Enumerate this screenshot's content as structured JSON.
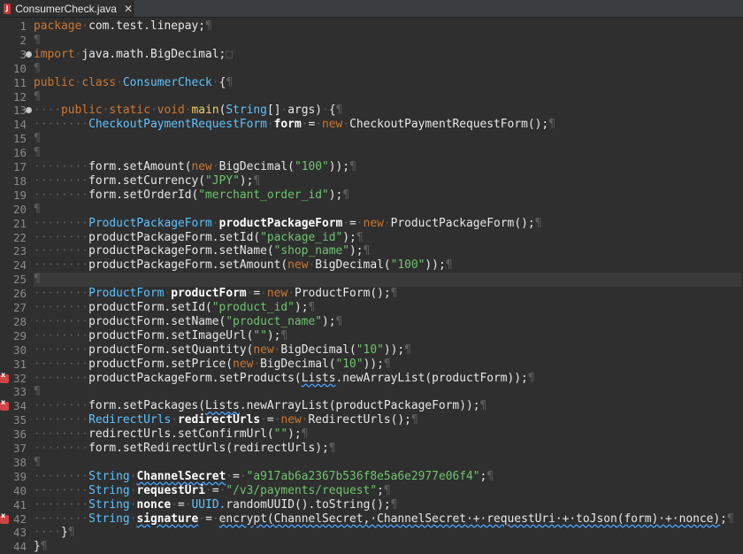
{
  "tab": {
    "title": "ConsumerCheck.java",
    "icon": "java-file-icon",
    "close_icon": "close-icon"
  },
  "gutter": {
    "line_numbers": [
      "1",
      "2",
      "3",
      "10",
      "11",
      "12",
      "13",
      "14",
      "15",
      "16",
      "17",
      "18",
      "19",
      "20",
      "21",
      "22",
      "23",
      "24",
      "25",
      "26",
      "27",
      "28",
      "29",
      "30",
      "31",
      "32",
      "33",
      "34",
      "35",
      "36",
      "37",
      "38",
      "39",
      "40",
      "41",
      "42",
      "43",
      "44"
    ],
    "fold_markers_lines": [
      "3",
      "13"
    ],
    "error_markers_lines": [
      "32",
      "34",
      "42"
    ]
  },
  "code": [
    {
      "tokens": [
        [
          "kw",
          "package"
        ],
        [
          "ws",
          "·"
        ],
        [
          "txt",
          "com.test.linepay;"
        ],
        [
          "ws",
          "¶"
        ]
      ]
    },
    {
      "tokens": [
        [
          "ws",
          "¶"
        ]
      ]
    },
    {
      "tokens": [
        [
          "kw",
          "import"
        ],
        [
          "ws",
          "·"
        ],
        [
          "txt",
          "java.math.BigDecimal;"
        ],
        [
          "ws",
          "□"
        ]
      ]
    },
    {
      "tokens": [
        [
          "ws",
          "¶"
        ]
      ]
    },
    {
      "tokens": [
        [
          "kw",
          "public"
        ],
        [
          "ws",
          "·"
        ],
        [
          "kw",
          "class"
        ],
        [
          "ws",
          "·"
        ],
        [
          "ty",
          "ConsumerCheck"
        ],
        [
          "ws",
          "·"
        ],
        [
          "txt",
          "{"
        ],
        [
          "ws",
          "¶"
        ]
      ]
    },
    {
      "tokens": [
        [
          "ws",
          "¶"
        ]
      ]
    },
    {
      "tokens": [
        [
          "ws",
          "····"
        ],
        [
          "kw",
          "public"
        ],
        [
          "ws",
          "·"
        ],
        [
          "kw",
          "static"
        ],
        [
          "ws",
          "·"
        ],
        [
          "kw",
          "void"
        ],
        [
          "ws",
          "·"
        ],
        [
          "method",
          "main"
        ],
        [
          "txt",
          "("
        ],
        [
          "ty",
          "String"
        ],
        [
          "txt",
          "[]"
        ],
        [
          "ws",
          "·"
        ],
        [
          "txt",
          "args)"
        ],
        [
          "ws",
          "·"
        ],
        [
          "txt",
          "{"
        ],
        [
          "ws",
          "¶"
        ]
      ]
    },
    {
      "tokens": [
        [
          "ws",
          "········"
        ],
        [
          "ty",
          "CheckoutPaymentRequestForm"
        ],
        [
          "ws",
          "·"
        ],
        [
          "fld",
          "form"
        ],
        [
          "ws",
          "·"
        ],
        [
          "txt",
          "="
        ],
        [
          "ws",
          "·"
        ],
        [
          "kw",
          "new"
        ],
        [
          "ws",
          "·"
        ],
        [
          "txt",
          "CheckoutPaymentRequestForm();"
        ],
        [
          "ws",
          "¶"
        ]
      ]
    },
    {
      "tokens": [
        [
          "ws",
          "¶"
        ]
      ]
    },
    {
      "tokens": [
        [
          "ws",
          "¶"
        ]
      ]
    },
    {
      "tokens": [
        [
          "ws",
          "········"
        ],
        [
          "txt",
          "form.setAmount("
        ],
        [
          "kw",
          "new"
        ],
        [
          "ws",
          "·"
        ],
        [
          "txt",
          "BigDecimal("
        ],
        [
          "str",
          "\"100\""
        ],
        [
          "txt",
          "));"
        ],
        [
          "ws",
          "¶"
        ]
      ]
    },
    {
      "tokens": [
        [
          "ws",
          "········"
        ],
        [
          "txt",
          "form.setCurrency("
        ],
        [
          "str",
          "\"JPY\""
        ],
        [
          "txt",
          ");"
        ],
        [
          "ws",
          "¶"
        ]
      ]
    },
    {
      "tokens": [
        [
          "ws",
          "········"
        ],
        [
          "txt",
          "form.setOrderId("
        ],
        [
          "str",
          "\"merchant_order_id\""
        ],
        [
          "txt",
          ");"
        ],
        [
          "ws",
          "¶"
        ]
      ]
    },
    {
      "tokens": [
        [
          "ws",
          "¶"
        ]
      ]
    },
    {
      "tokens": [
        [
          "ws",
          "········"
        ],
        [
          "ty",
          "ProductPackageForm"
        ],
        [
          "ws",
          "·"
        ],
        [
          "fld",
          "productPackageForm"
        ],
        [
          "ws",
          "·"
        ],
        [
          "txt",
          "="
        ],
        [
          "ws",
          "·"
        ],
        [
          "kw",
          "new"
        ],
        [
          "ws",
          "·"
        ],
        [
          "txt",
          "ProductPackageForm();"
        ],
        [
          "ws",
          "¶"
        ]
      ]
    },
    {
      "tokens": [
        [
          "ws",
          "········"
        ],
        [
          "txt",
          "productPackageForm.setId("
        ],
        [
          "str",
          "\"package_id\""
        ],
        [
          "txt",
          ");"
        ],
        [
          "ws",
          "¶"
        ]
      ]
    },
    {
      "tokens": [
        [
          "ws",
          "········"
        ],
        [
          "txt",
          "productPackageForm.setName("
        ],
        [
          "str",
          "\"shop_name\""
        ],
        [
          "txt",
          ");"
        ],
        [
          "ws",
          "¶"
        ]
      ]
    },
    {
      "tokens": [
        [
          "ws",
          "········"
        ],
        [
          "txt",
          "productPackageForm.setAmount("
        ],
        [
          "kw",
          "new"
        ],
        [
          "ws",
          "·"
        ],
        [
          "txt",
          "BigDecimal("
        ],
        [
          "str",
          "\"100\""
        ],
        [
          "txt",
          "));"
        ],
        [
          "ws",
          "¶"
        ]
      ]
    },
    {
      "tokens": [
        [
          "ws",
          "¶"
        ]
      ],
      "current": true
    },
    {
      "tokens": [
        [
          "ws",
          "········"
        ],
        [
          "ty",
          "ProductForm"
        ],
        [
          "ws",
          "·"
        ],
        [
          "fld",
          "productForm"
        ],
        [
          "ws",
          "·"
        ],
        [
          "txt",
          "="
        ],
        [
          "ws",
          "·"
        ],
        [
          "kw",
          "new"
        ],
        [
          "ws",
          "·"
        ],
        [
          "txt",
          "ProductForm();"
        ],
        [
          "ws",
          "¶"
        ]
      ]
    },
    {
      "tokens": [
        [
          "ws",
          "········"
        ],
        [
          "txt",
          "productForm.setId("
        ],
        [
          "str",
          "\"product_id\""
        ],
        [
          "txt",
          ");"
        ],
        [
          "ws",
          "¶"
        ]
      ]
    },
    {
      "tokens": [
        [
          "ws",
          "········"
        ],
        [
          "txt",
          "productForm.setName("
        ],
        [
          "str",
          "\"product_name\""
        ],
        [
          "txt",
          ");"
        ],
        [
          "ws",
          "¶"
        ]
      ]
    },
    {
      "tokens": [
        [
          "ws",
          "········"
        ],
        [
          "txt",
          "productForm.setImageUrl("
        ],
        [
          "str",
          "\"\""
        ],
        [
          "txt",
          ");"
        ],
        [
          "ws",
          "¶"
        ]
      ]
    },
    {
      "tokens": [
        [
          "ws",
          "········"
        ],
        [
          "txt",
          "productForm.setQuantity("
        ],
        [
          "kw",
          "new"
        ],
        [
          "ws",
          "·"
        ],
        [
          "txt",
          "BigDecimal("
        ],
        [
          "str",
          "\"10\""
        ],
        [
          "txt",
          "));"
        ],
        [
          "ws",
          "¶"
        ]
      ]
    },
    {
      "tokens": [
        [
          "ws",
          "········"
        ],
        [
          "txt",
          "productForm.setPrice("
        ],
        [
          "kw",
          "new"
        ],
        [
          "ws",
          "·"
        ],
        [
          "txt",
          "BigDecimal("
        ],
        [
          "str",
          "\"10\""
        ],
        [
          "txt",
          "));"
        ],
        [
          "ws",
          "¶"
        ]
      ]
    },
    {
      "tokens": [
        [
          "ws",
          "········"
        ],
        [
          "txt",
          "productPackageForm.setProducts("
        ],
        [
          "ul",
          "Lists"
        ],
        [
          "txt",
          ".newArrayList(productForm));"
        ],
        [
          "ws",
          "¶"
        ]
      ]
    },
    {
      "tokens": [
        [
          "ws",
          "¶"
        ]
      ]
    },
    {
      "tokens": [
        [
          "ws",
          "········"
        ],
        [
          "txt",
          "form.setPackages("
        ],
        [
          "ul",
          "Lists"
        ],
        [
          "txt",
          ".newArrayList(productPackageForm));"
        ],
        [
          "ws",
          "¶"
        ]
      ]
    },
    {
      "tokens": [
        [
          "ws",
          "········"
        ],
        [
          "ty",
          "RedirectUrls"
        ],
        [
          "ws",
          "·"
        ],
        [
          "fld",
          "redirectUrls"
        ],
        [
          "ws",
          "·"
        ],
        [
          "txt",
          "="
        ],
        [
          "ws",
          "·"
        ],
        [
          "kw",
          "new"
        ],
        [
          "ws",
          "·"
        ],
        [
          "txt",
          "RedirectUrls();"
        ],
        [
          "ws",
          "¶"
        ]
      ]
    },
    {
      "tokens": [
        [
          "ws",
          "········"
        ],
        [
          "txt",
          "redirectUrls.setConfirmUrl("
        ],
        [
          "str",
          "\"\""
        ],
        [
          "txt",
          ");"
        ],
        [
          "ws",
          "¶"
        ]
      ]
    },
    {
      "tokens": [
        [
          "ws",
          "········"
        ],
        [
          "txt",
          "form.setRedirectUrls(redirectUrls);"
        ],
        [
          "ws",
          "¶"
        ]
      ]
    },
    {
      "tokens": [
        [
          "ws",
          "¶"
        ]
      ]
    },
    {
      "tokens": [
        [
          "ws",
          "········"
        ],
        [
          "ty",
          "String"
        ],
        [
          "ws",
          "·"
        ],
        [
          "fldul",
          "ChannelSecret"
        ],
        [
          "ws",
          "·"
        ],
        [
          "txt",
          "="
        ],
        [
          "ws",
          "·"
        ],
        [
          "str",
          "\"a917ab6a2367b536f8e5a6e2977e06f4\""
        ],
        [
          "txt",
          ";"
        ],
        [
          "ws",
          "¶"
        ]
      ]
    },
    {
      "tokens": [
        [
          "ws",
          "········"
        ],
        [
          "ty",
          "String"
        ],
        [
          "ws",
          "·"
        ],
        [
          "fld",
          "requestUri"
        ],
        [
          "ws",
          "·"
        ],
        [
          "txt",
          "="
        ],
        [
          "ws",
          "·"
        ],
        [
          "str",
          "\"/v3/payments/request\""
        ],
        [
          "txt",
          ";"
        ],
        [
          "ws",
          "¶"
        ]
      ]
    },
    {
      "tokens": [
        [
          "ws",
          "········"
        ],
        [
          "ty",
          "String"
        ],
        [
          "ws",
          "·"
        ],
        [
          "fld",
          "nonce"
        ],
        [
          "ws",
          "·"
        ],
        [
          "txt",
          "="
        ],
        [
          "ws",
          "·"
        ],
        [
          "ty",
          "UUID."
        ],
        [
          "txt",
          "randomUUID().toString();"
        ],
        [
          "ws",
          "¶"
        ]
      ]
    },
    {
      "tokens": [
        [
          "ws",
          "········"
        ],
        [
          "ty",
          "String"
        ],
        [
          "ws",
          "·"
        ],
        [
          "fldul",
          "signature"
        ],
        [
          "ws",
          "·"
        ],
        [
          "txt",
          "="
        ],
        [
          "ws",
          "·"
        ],
        [
          "ul",
          "encrypt(ChannelSecret,·ChannelSecret·+·requestUri·+·toJson(form)·+·nonce)"
        ],
        [
          "txt",
          ";"
        ],
        [
          "ws",
          "¶"
        ]
      ]
    },
    {
      "tokens": [
        [
          "ws",
          "····"
        ],
        [
          "txt",
          "}"
        ],
        [
          "ws",
          "¶"
        ]
      ]
    },
    {
      "tokens": [
        [
          "txt",
          "}"
        ],
        [
          "ws",
          "¶"
        ]
      ]
    }
  ]
}
